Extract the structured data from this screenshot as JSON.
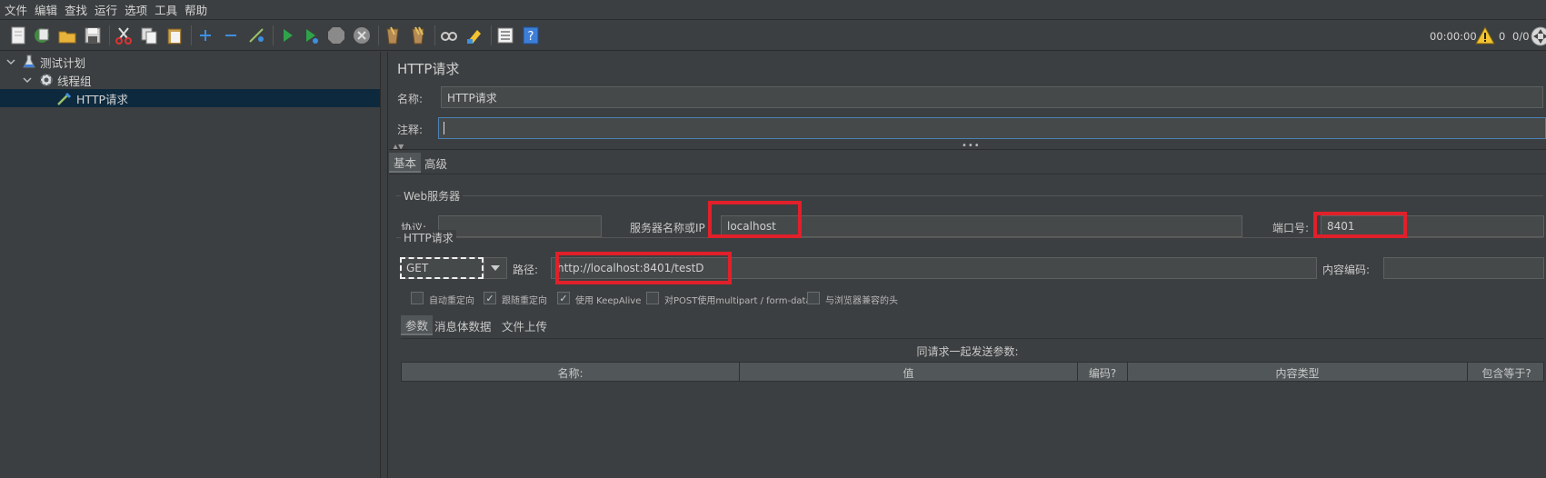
{
  "menu": [
    "文件",
    "编辑",
    "查找",
    "运行",
    "选项",
    "工具",
    "帮助"
  ],
  "toolbar_icons": [
    "new-icon",
    "templates-icon",
    "open-icon",
    "save-icon",
    "cut-icon",
    "copy-icon",
    "paste-icon",
    "expand-icon",
    "collapse-icon",
    "toggle-icon",
    "start-icon",
    "start-no-pause-icon",
    "stop-icon",
    "shutdown-icon",
    "clear-icon",
    "clear-all-icon",
    "search-icon",
    "reset-search-icon",
    "function-helper-icon",
    "help-icon"
  ],
  "status": {
    "timer": "00:00:00",
    "warnings": "0",
    "threads": "0/0"
  },
  "tree": {
    "plan": "测试计划",
    "thread_group": "线程组",
    "sampler": "HTTP请求"
  },
  "panel": {
    "title": "HTTP请求",
    "name_label": "名称:",
    "name_value": "HTTP请求",
    "comment_label": "注释:",
    "comment_value": "",
    "tabs": [
      "基本",
      "高级"
    ],
    "web_server": {
      "title": "Web服务器",
      "protocol_label": "协议:",
      "protocol_value": "",
      "server_label": "服务器名称或IP",
      "server_value": "localhost",
      "port_label": "端口号:",
      "port_value": "8401"
    },
    "http_request": {
      "title": "HTTP请求",
      "method": "GET",
      "path_label": "路径:",
      "path_value": "http://localhost:8401/testD",
      "encoding_label": "内容编码:",
      "encoding_value": ""
    },
    "options": [
      {
        "label": "自动重定向",
        "checked": false
      },
      {
        "label": "跟随重定向",
        "checked": true
      },
      {
        "label": "使用 KeepAlive",
        "checked": true
      },
      {
        "label": "对POST使用multipart / form-data",
        "checked": false
      },
      {
        "label": "与浏览器兼容的头",
        "checked": false
      }
    ],
    "subtabs": [
      "参数",
      "消息体数据",
      "文件上传"
    ],
    "params_caption": "同请求一起发送参数:",
    "columns": [
      "名称:",
      "值",
      "编码?",
      "内容类型",
      "包含等于?"
    ]
  },
  "colors": {
    "highlight": "#e0202a",
    "selection": "#0d293e",
    "background": "#3c3f41"
  }
}
